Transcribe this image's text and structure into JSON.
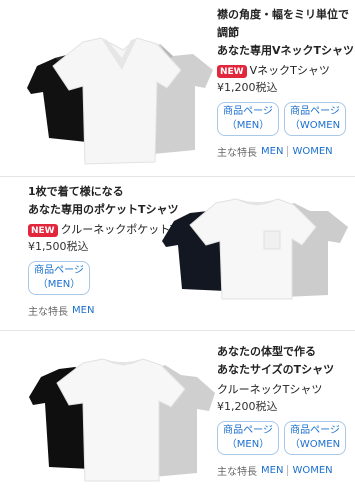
{
  "products": [
    {
      "title_lines": [
        "襟の角度・幅をミリ単位で",
        "調節",
        "あなた専用VネックTシャツ"
      ],
      "new_badge": "NEW",
      "name": "VネックTシャツ",
      "price": "¥1,200税込",
      "buttons": [
        {
          "line1": "商品ページ",
          "line2": "（MEN）"
        },
        {
          "line1": "商品ページ",
          "line2": "（WOMEN"
        }
      ],
      "features_label": "主な特長",
      "features_links": [
        "MEN",
        "WOMEN"
      ]
    },
    {
      "title_lines": [
        "1枚で着て様になる",
        "あなた専用のポケットTシャツ"
      ],
      "new_badge": "NEW",
      "name": "クルーネックポケットT",
      "price": "¥1,500税込",
      "buttons": [
        {
          "line1": "商品ページ",
          "line2": "（MEN）"
        }
      ],
      "features_label": "主な特長",
      "features_links": [
        "MEN"
      ]
    },
    {
      "title_lines": [
        "あなたの体型で作る",
        "あなたサイズのTシャツ"
      ],
      "name": "クルーネックTシャツ",
      "price": "¥1,200税込",
      "buttons": [
        {
          "line1": "商品ページ",
          "line2": "（MEN）"
        },
        {
          "line1": "商品ページ",
          "line2": "（WOMEN"
        }
      ],
      "features_label": "主な特長",
      "features_links": [
        "MEN",
        "WOMEN"
      ]
    }
  ],
  "colors": {
    "badge": "#e2273d",
    "link": "#1a6fcf",
    "button_border": "#a9c8e8"
  },
  "images": [
    "vneck-tshirt-trio-image",
    "pocket-tshirt-trio-image",
    "crewneck-tshirt-trio-image"
  ]
}
